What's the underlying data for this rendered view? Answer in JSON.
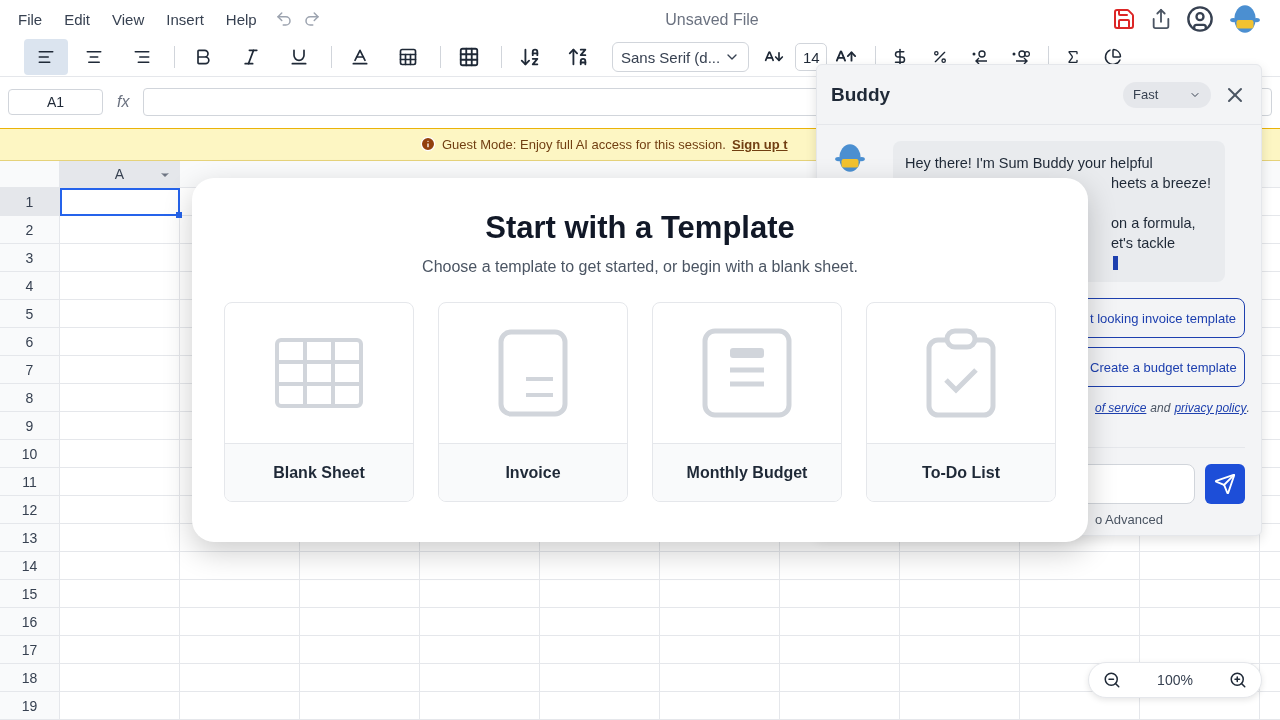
{
  "menu": [
    "File",
    "Edit",
    "View",
    "Insert",
    "Help"
  ],
  "document_title": "Unsaved File",
  "toolbar": {
    "align": [
      {
        "selected": true
      },
      {
        "selected": false
      },
      {
        "selected": false
      }
    ],
    "font": "Sans Serif (d...",
    "font_size": "14"
  },
  "formula_bar": {
    "cell_ref": "A1",
    "fx": "fx"
  },
  "banner": {
    "text": "Guest Mode: Enjoy full AI access for this session.",
    "link": "Sign up t"
  },
  "grid": {
    "columns": [
      "A"
    ],
    "rows": [
      "1",
      "2",
      "3",
      "4",
      "5",
      "6",
      "7",
      "8",
      "9",
      "10",
      "11",
      "12",
      "13",
      "14",
      "15",
      "16",
      "17",
      "18",
      "19"
    ]
  },
  "chat": {
    "title": "Buddy",
    "model": "Fast",
    "greeting": "Hey there! I'm Sum Buddy your helpful",
    "fragments": [
      "heets a breeze!",
      "on a formula,",
      "et's tackle"
    ],
    "suggestions": [
      "t looking invoice template",
      "Create a budget template"
    ],
    "terms": {
      "link1": "of service",
      "middle": "and",
      "link2": "privacy policy",
      "end": "."
    },
    "mode_note": "o Advanced"
  },
  "modal": {
    "title": "Start with a Template",
    "subtitle": "Choose a template to get started, or begin with a blank sheet.",
    "templates": [
      {
        "kind": "blank",
        "label": "Blank Sheet"
      },
      {
        "kind": "invoice",
        "label": "Invoice"
      },
      {
        "kind": "budget",
        "label": "Monthly Budget"
      },
      {
        "kind": "todo",
        "label": "To-Do List"
      }
    ]
  },
  "zoom": "100%"
}
